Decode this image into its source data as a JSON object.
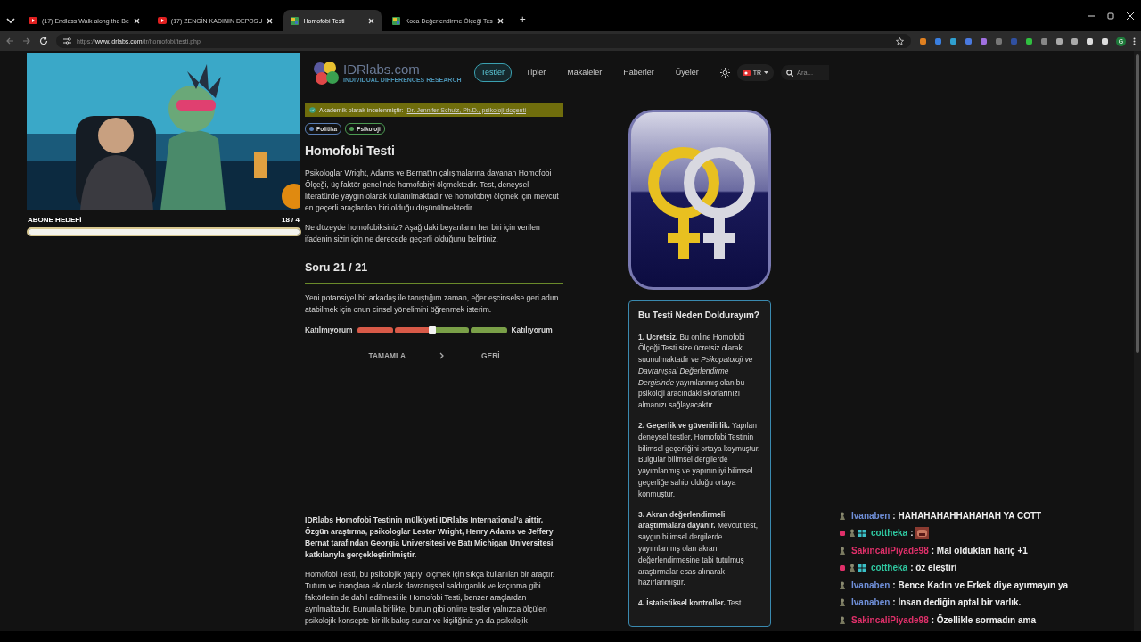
{
  "browser": {
    "tabs": [
      {
        "title": "(17) Endless Walk along the Be",
        "kind": "video",
        "selected": false
      },
      {
        "title": "(17) ZENGİN KADININ DEPOSU",
        "kind": "video",
        "selected": false
      },
      {
        "title": "Homofobi Testi",
        "kind": "site",
        "selected": true
      },
      {
        "title": "Koca Değerlendirme Ölçeği Tes",
        "kind": "site",
        "selected": false
      }
    ],
    "new_tab": "+",
    "url": "https://**www.idrlabs.com**/tr/homofobi/testi.php",
    "profile_initial": "G"
  },
  "stream": {
    "goal": {
      "label": "ABONE HEDEFİ",
      "count": "18 / 4",
      "level": 1
    }
  },
  "site": {
    "logo": {
      "name": "IDRlabs.com",
      "tagline": "INDIVIDUAL DIFFERENCES RESEARCH"
    },
    "nav": [
      {
        "label": "Testler",
        "selected": true
      },
      {
        "label": "Tipler",
        "selected": false
      },
      {
        "label": "Makaleler",
        "selected": false
      },
      {
        "label": "Haberler",
        "selected": false
      },
      {
        "label": "Üyeler",
        "selected": false
      }
    ],
    "language": "TR",
    "search": {
      "placeholder": "Ara..."
    },
    "review": {
      "label": "Akademik olarak incelenmiştir:",
      "reviewer": "Dr. Jennifer Schulz, Ph.D., psikoloji doçenti"
    },
    "tags": [
      {
        "label": "Politika",
        "color": "#5b7fb5"
      },
      {
        "label": "Psikoloji",
        "color": "#4c9a52"
      }
    ],
    "title": "Homofobi Testi",
    "intro": [
      "Psikologlar Wright, Adams ve Bernat’ın çalışmalarına dayanan Homofobi Ölçeği, üç faktör genelinde homofobiyi ölçmektedir. Test, deneysel literatürde yaygın olarak kullanılmaktadır ve homofobiyi ölçmek için mevcut en geçerli araçlardan biri olduğu düşünülmektedir.",
      "Ne düzeyde homofobiksiniz? Aşağıdaki beyanların her biri için verilen ifadenin sizin için ne derecede geçerli olduğunu belirtiniz."
    ],
    "question": {
      "heading": "Soru 21 / 21",
      "progress": {
        "level": 1
      },
      "text": "Yeni potansiyel bir arkadaş ile tanıştığım zaman, eğer eşcinselse geri adım atabilmek için onun cinsel yönelimini öğrenmek isterim.",
      "scale": {
        "left": "Katılmıyorum",
        "right": "Katılıyorum",
        "level": 0.5
      },
      "buttons": [
        {
          "label": "TAMAMLA",
          "kind": "next"
        },
        {
          "label": "GERİ",
          "kind": "back"
        }
      ]
    },
    "ownership": "IDRlabs Homofobi Testinin mülkiyeti IDRlabs International’a aittir. Özgün araştırma, psikologlar Lester Wright, Henry Adams ve Jeffery Bernat tarafından Georgia Üniversitesi ve Batı Michigan Üniversitesi katkılarıyla gerçekleştirilmiştir.",
    "description": "Homofobi Testi, bu psikolojik yapıyı ölçmek için sıkça kullanılan bir araçtır. Tutum ve inançlara ek olarak davranışsal saldırganlık ve kaçınma gibi faktörlerin de dahil edilmesi ile Homofobi Testi, benzer araçlardan ayrılmaktadır. Bununla birlikte, bunun gibi online testler yalnızca ölçülen psikolojik konsepte bir ilk bakış sunar ve kişiliğiniz ya da psikolojik",
    "card": {
      "title": "Bu Testi Neden Doldurayım?",
      "items": [
        "**1. Ücretsiz.** Bu online Homofobi Ölçeği Testi size ücretsiz olarak suunulmaktadir ve *Psikopatoloji ve Davranışsal Değerlendirme Dergisinde* yayımlanmış olan bu psikoloji aracındaki skorlarınızı almanızı sağlayacaktır.",
        "**2. Geçerlik ve güvenilirlik.** Yapılan deneysel testler, Homofobi Testinin bilimsel geçerliğini ortaya koymuştur. Bulgular bilimsel dergilerde yayımlanmış ve yapının iyi bilimsel geçerliğe sahip olduğu ortaya konmuştur.",
        "**3. Akran değerlendirmeli araştırmalara dayanır.** Mevcut test, saygın bilimsel dergilerde yayımlanmış olan akran değerlendirmesine tabi tutulmuş araştırmalar esas alınarak hazırlanmıştır.",
        "**4. İstatistiksel kontroller.** Test"
      ]
    }
  },
  "chat": {
    "messages": [
      {
        "user": "Ivanaben",
        "color": "#6f8fd8",
        "badges": [
          {
            "kind": "pawn"
          }
        ],
        "text": ": HAHAHAHAHHAHAHAH YA COTT"
      },
      {
        "user": "cottheka",
        "color": "#2fc7a0",
        "badges": [
          {
            "kind": "gem"
          },
          {
            "kind": "pawn"
          },
          {
            "kind": "grid"
          }
        ],
        "text": ":",
        "emote": true
      },
      {
        "user": "SakincaliPiyade98",
        "color": "#e0306a",
        "badges": [
          {
            "kind": "pawn"
          }
        ],
        "text": ": Mal oldukları hariç +1"
      },
      {
        "user": "cottheka",
        "color": "#2fc7a0",
        "badges": [
          {
            "kind": "gem"
          },
          {
            "kind": "pawn"
          },
          {
            "kind": "grid"
          }
        ],
        "text": ": öz eleştiri"
      },
      {
        "user": "Ivanaben",
        "color": "#6f8fd8",
        "badges": [
          {
            "kind": "pawn"
          }
        ],
        "text": ": Bence Kadın ve Erkek diye ayırmayın ya"
      },
      {
        "user": "Ivanaben",
        "color": "#6f8fd8",
        "badges": [
          {
            "kind": "pawn"
          }
        ],
        "text": ": İnsan dediğin aptal bir varlık."
      },
      {
        "user": "SakincaliPiyade98",
        "color": "#e0306a",
        "badges": [
          {
            "kind": "pawn"
          }
        ],
        "text": ": Özellikle sormadın ama"
      }
    ]
  }
}
